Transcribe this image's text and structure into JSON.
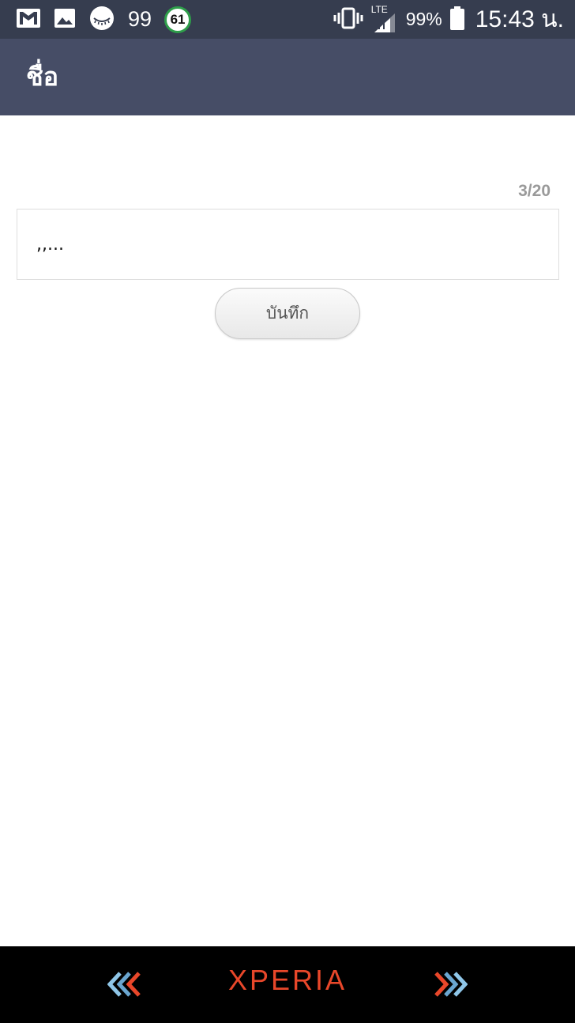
{
  "status_bar": {
    "notification_count": "99",
    "badge_value": "61",
    "network_type": "LTE",
    "battery_percent": "99%",
    "time": "15:43 น.",
    "icons": [
      "gmail-icon",
      "gallery-icon",
      "sleep-face-icon",
      "vibrate-icon",
      "signal-icon",
      "battery-icon"
    ]
  },
  "app_bar": {
    "title": "ชื่อ"
  },
  "form": {
    "char_counter": "3/20",
    "name_value": ",,...",
    "save_label": "บันทึก"
  },
  "nav_bar": {
    "brand": "XPERIA",
    "colors": {
      "brand": "#e8472a",
      "chevron_left": "#8fc6e8",
      "chevron_right": "#e8472a"
    }
  },
  "colors": {
    "status_bar_bg": "#363d4f",
    "app_bar_bg": "#464d66",
    "badge_ring": "#2e9e4a"
  }
}
